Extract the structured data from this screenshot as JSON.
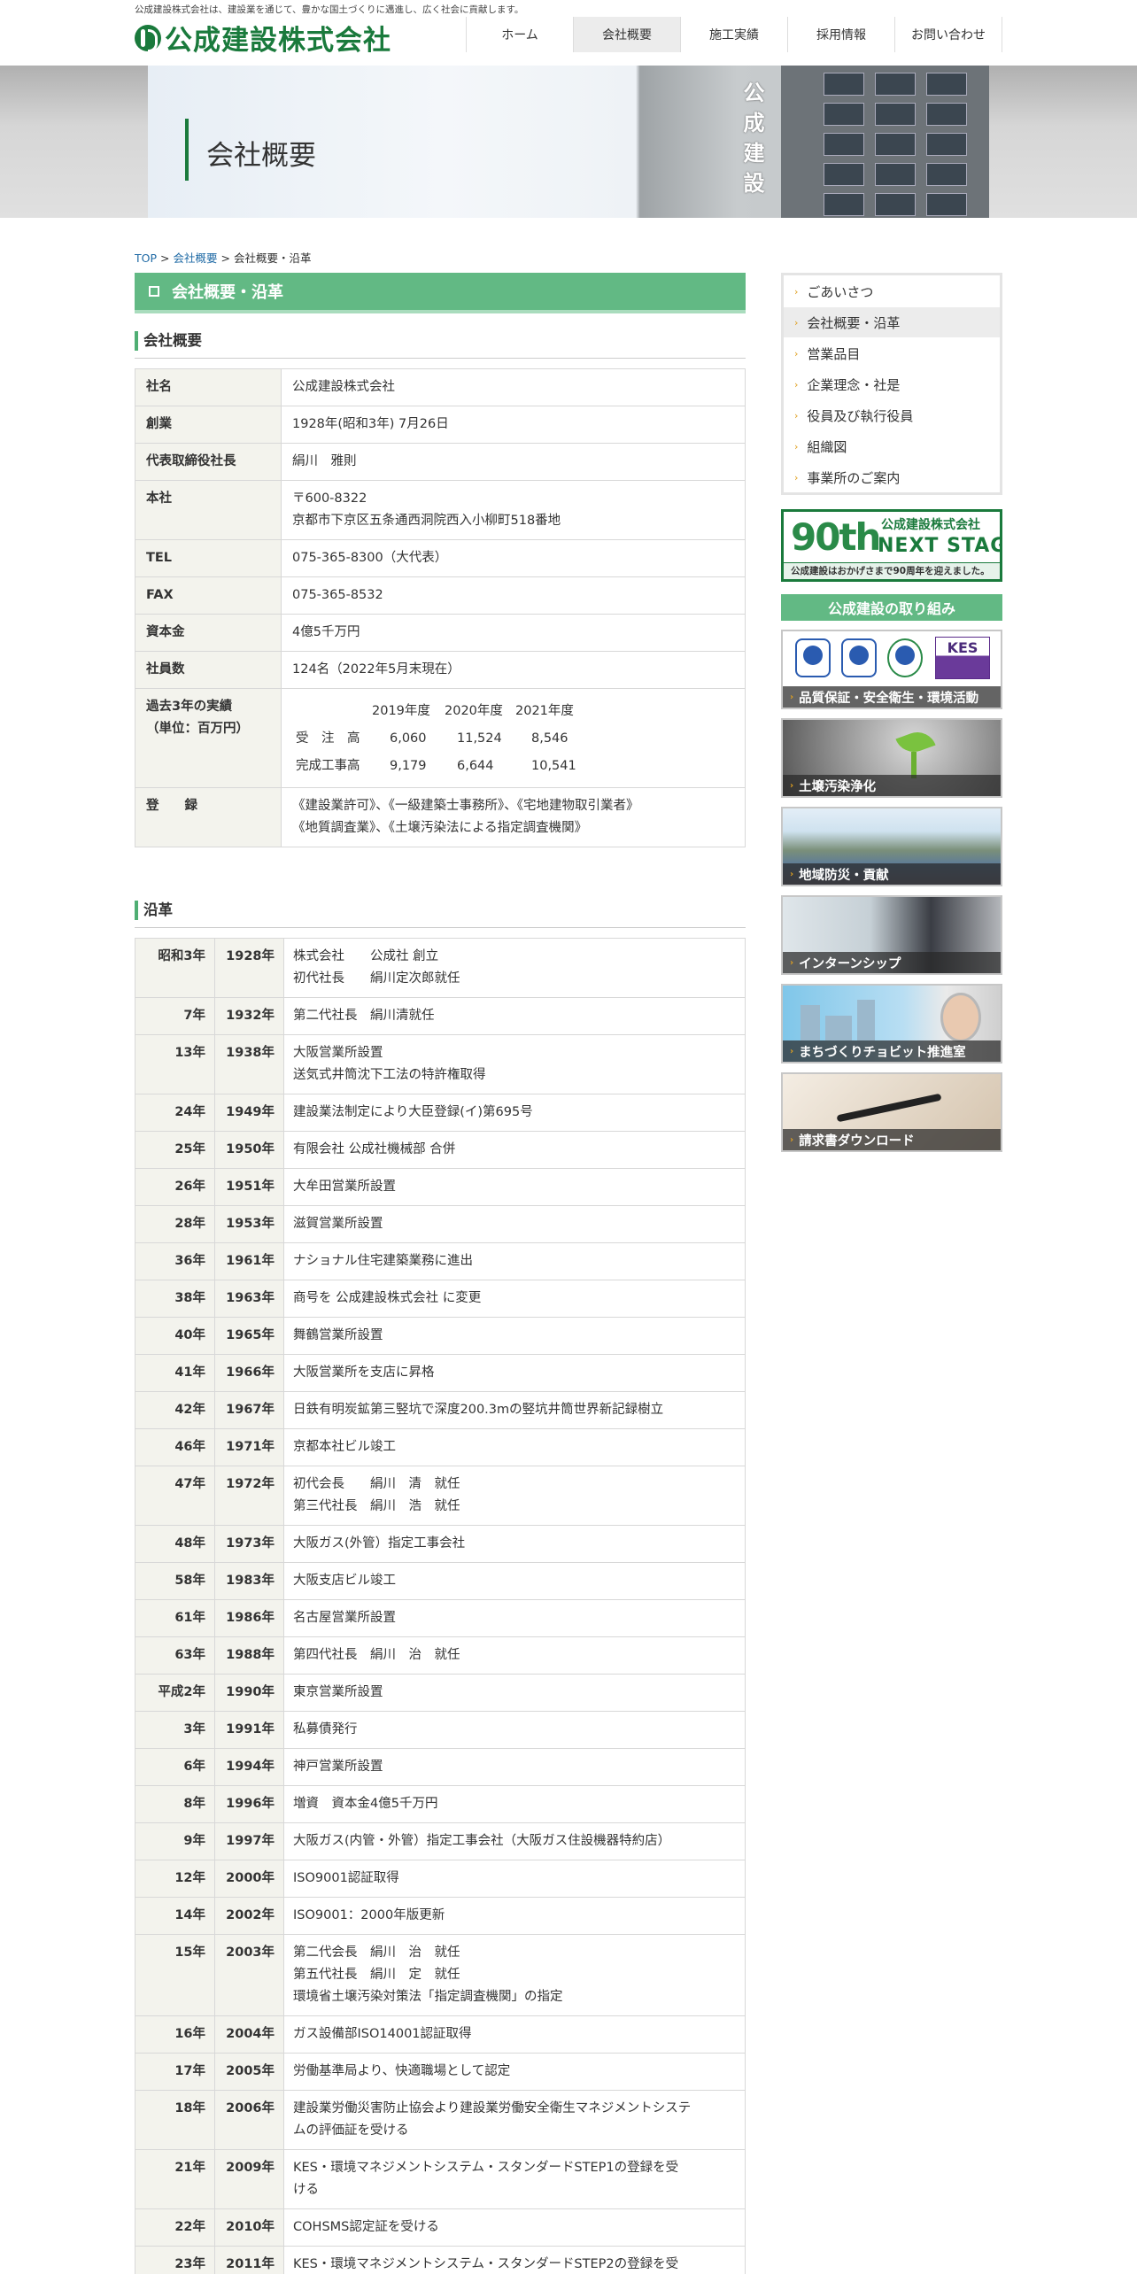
{
  "header": {
    "tagline": "公成建設株式会社は、建設業を通じて、豊かな国土づくりに邁進し、広く社会に貢献します。",
    "logo_text": "公成建設株式会社",
    "nav": [
      {
        "label": "ホーム"
      },
      {
        "label": "会社概要"
      },
      {
        "label": "施工実績"
      },
      {
        "label": "採用情報"
      },
      {
        "label": "お問い合わせ"
      }
    ]
  },
  "hero": {
    "title": "会社概要",
    "sign_text": "公成建設"
  },
  "breadcrumb": {
    "top": "TOP",
    "sep": ">",
    "parent": "会社概要",
    "current": "会社概要・沿革"
  },
  "main": {
    "title": "会社概要・沿革",
    "profile_heading": "会社概要",
    "profile": {
      "company_key": "社名",
      "company_val": "公成建設株式会社",
      "founded_key": "創業",
      "founded_val": "1928年(昭和3年) 7月26日",
      "ceo_key": "代表取締役社長",
      "ceo_val": "絹川　雅則",
      "hq_key": "本社",
      "hq_zip": "〒600-8322",
      "hq_addr": "京都市下京区五条通西洞院西入小柳町518番地",
      "tel_key": "TEL",
      "tel_val": "075-365-8300（大代表）",
      "fax_key": "FAX",
      "fax_val": "075-365-8532",
      "capital_key": "資本金",
      "capital_val": "4億5千万円",
      "employees_key": "社員数",
      "employees_val": "124名（2022年5月末現在）",
      "perf_key_1": "過去3年の実績",
      "perf_key_2": "（単位：百万円）",
      "perf_years": [
        "2019年度",
        "2020年度",
        "2021年度"
      ],
      "perf_rows": [
        {
          "label": "受　注　高",
          "values": [
            "6,060",
            "11,524",
            "8,546"
          ]
        },
        {
          "label": "完成工事高",
          "values": [
            "9,179",
            "6,644",
            "10,541"
          ]
        }
      ],
      "reg_key": "登　　録",
      "reg_line1": "《建設業許可》、《一級建築士事務所》、《宅地建物取引業者》",
      "reg_line2": "《地質調査業》、《土壌汚染法による指定調査機関》"
    },
    "history_heading": "沿革",
    "history": [
      {
        "era": "昭和3年",
        "year": "1928年",
        "lines": [
          "株式会社　　公成社 創立",
          "初代社長　　絹川定次郎就任"
        ]
      },
      {
        "era": "7年",
        "year": "1932年",
        "lines": [
          "第二代社長　絹川清就任"
        ]
      },
      {
        "era": "13年",
        "year": "1938年",
        "lines": [
          "大阪営業所設置",
          "送気式井筒沈下工法の特許権取得"
        ]
      },
      {
        "era": "24年",
        "year": "1949年",
        "lines": [
          "建設業法制定により大臣登録(イ)第695号"
        ]
      },
      {
        "era": "25年",
        "year": "1950年",
        "lines": [
          "有限会社 公成社機械部 合併"
        ]
      },
      {
        "era": "26年",
        "year": "1951年",
        "lines": [
          "大牟田営業所設置"
        ]
      },
      {
        "era": "28年",
        "year": "1953年",
        "lines": [
          "滋賀営業所設置"
        ]
      },
      {
        "era": "36年",
        "year": "1961年",
        "lines": [
          "ナショナル住宅建築業務に進出"
        ]
      },
      {
        "era": "38年",
        "year": "1963年",
        "lines": [
          "商号を 公成建設株式会社 に変更"
        ]
      },
      {
        "era": "40年",
        "year": "1965年",
        "lines": [
          "舞鶴営業所設置"
        ]
      },
      {
        "era": "41年",
        "year": "1966年",
        "lines": [
          "大阪営業所を支店に昇格"
        ]
      },
      {
        "era": "42年",
        "year": "1967年",
        "lines": [
          "日鉄有明炭鉱第三竪坑で深度200.3mの竪坑井筒世界新記録樹立"
        ]
      },
      {
        "era": "46年",
        "year": "1971年",
        "lines": [
          "京都本社ビル竣工"
        ]
      },
      {
        "era": "47年",
        "year": "1972年",
        "lines": [
          "初代会長　　絹川　清　就任",
          "第三代社長　絹川　浩　就任"
        ]
      },
      {
        "era": "48年",
        "year": "1973年",
        "lines": [
          "大阪ガス(外管）指定工事会社"
        ]
      },
      {
        "era": "58年",
        "year": "1983年",
        "lines": [
          "大阪支店ビル竣工"
        ]
      },
      {
        "era": "61年",
        "year": "1986年",
        "lines": [
          "名古屋営業所設置"
        ]
      },
      {
        "era": "63年",
        "year": "1988年",
        "lines": [
          "第四代社長　絹川　治　就任"
        ]
      },
      {
        "era": "平成2年",
        "year": "1990年",
        "lines": [
          "東京営業所設置"
        ]
      },
      {
        "era": "3年",
        "year": "1991年",
        "lines": [
          "私募債発行"
        ]
      },
      {
        "era": "6年",
        "year": "1994年",
        "lines": [
          "神戸営業所設置"
        ]
      },
      {
        "era": "8年",
        "year": "1996年",
        "lines": [
          "増資　資本金4億5千万円"
        ]
      },
      {
        "era": "9年",
        "year": "1997年",
        "lines": [
          "大阪ガス(内管・外管）指定工事会社（大阪ガス住設機器特約店）"
        ]
      },
      {
        "era": "12年",
        "year": "2000年",
        "lines": [
          "ISO9001認証取得"
        ]
      },
      {
        "era": "14年",
        "year": "2002年",
        "lines": [
          "ISO9001：2000年版更新"
        ]
      },
      {
        "era": "15年",
        "year": "2003年",
        "lines": [
          "第二代会長　絹川　治　就任",
          "第五代社長　絹川　定　就任",
          "環境省土壌汚染対策法「指定調査機関」の指定"
        ]
      },
      {
        "era": "16年",
        "year": "2004年",
        "lines": [
          "ガス設備部ISO14001認証取得"
        ]
      },
      {
        "era": "17年",
        "year": "2005年",
        "lines": [
          "労働基準局より、快適職場として認定"
        ]
      },
      {
        "era": "18年",
        "year": "2006年",
        "lines": [
          "建設業労働災害防止協会より建設業労働安全衛生マネジメントシステ",
          "ムの評価証を受ける"
        ]
      },
      {
        "era": "21年",
        "year": "2009年",
        "lines": [
          "KES・環境マネジメントシステム・スタンダードSTEP1の登録を受",
          "ける"
        ]
      },
      {
        "era": "22年",
        "year": "2010年",
        "lines": [
          "COHSMS認定証を受ける"
        ]
      },
      {
        "era": "23年",
        "year": "2011年",
        "lines": [
          "KES・環境マネジメントシステム・スタンダードSTEP2の登録を受"
        ]
      }
    ]
  },
  "sidebar": {
    "nav": [
      {
        "label": "ごあいさつ"
      },
      {
        "label": "会社概要・沿革"
      },
      {
        "label": "営業品目"
      },
      {
        "label": "企業理念・社是"
      },
      {
        "label": "役員及び執行役員"
      },
      {
        "label": "組織図"
      },
      {
        "label": "事業所のご案内"
      }
    ],
    "banner90": {
      "num": "90th",
      "company": "公成建設株式会社",
      "next": "NEXT STAGE",
      "sub": "公成建設はおかげさまで90周年を迎えました。"
    },
    "heading": "公成建設の取り組み",
    "banners": [
      {
        "label": "品質保証・安全衛生・環境活動",
        "kes": "KES"
      },
      {
        "label": "土壌汚染浄化"
      },
      {
        "label": "地域防災・貢献"
      },
      {
        "label": "インターンシップ"
      },
      {
        "label": "まちづくりチョビット推進室"
      },
      {
        "label": "請求書ダウンロード"
      }
    ]
  },
  "colors": {
    "brand_green": "#1a7a3c",
    "heading_green": "#62b984",
    "link_blue": "#1f6aa5"
  }
}
